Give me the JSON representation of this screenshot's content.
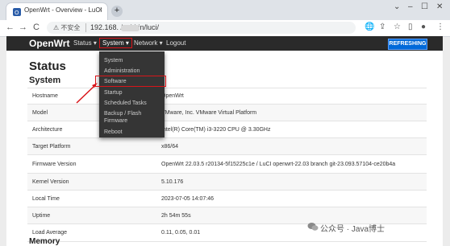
{
  "browser": {
    "tab_title": "OpenWrt - Overview - LuCI",
    "tab_close": "×",
    "new_tab": "+",
    "window_controls": [
      "⌄",
      "–",
      "☐",
      "✕"
    ],
    "security_label": "⚠ 不安全",
    "url": "192.168.              /cgi-bin/luci/",
    "nav": {
      "back": "←",
      "forward": "→",
      "reload": "C"
    }
  },
  "header": {
    "brand": "OpenWrt",
    "menu": {
      "status": "Status ▾",
      "system": "System ▾",
      "network": "Network ▾",
      "logout": "Logout"
    },
    "refresh_label": "REFRESHING",
    "colors": {
      "bar": "#2a2a2a",
      "refresh": "#0069d9",
      "highlight": "#d9151a"
    }
  },
  "dropdown": {
    "items": [
      "System",
      "Administration",
      "Software",
      "Startup",
      "Scheduled Tasks",
      "Backup / Flash",
      "Firmware",
      "Reboot"
    ],
    "highlighted": "Software"
  },
  "page": {
    "title": "Status",
    "section": "System",
    "rows": [
      {
        "label": "Hostname",
        "value": "OpenWrt"
      },
      {
        "label": "Model",
        "value": "VMware, Inc. VMware Virtual Platform"
      },
      {
        "label": "Architecture",
        "value": "Intel(R) Core(TM) i3-3220 CPU @ 3.30GHz"
      },
      {
        "label": "Target Platform",
        "value": "x86/64"
      },
      {
        "label": "Firmware Version",
        "value": "OpenWrt 22.03.5 r20134-5f15225c1e / LuCI openwrt-22.03 branch git-23.093.57104-ce20b4a"
      },
      {
        "label": "Kernel Version",
        "value": "5.10.176"
      },
      {
        "label": "Local Time",
        "value": "2023-07-05 14:07:46"
      },
      {
        "label": "Uptime",
        "value": "2h 54m 55s"
      },
      {
        "label": "Load Average",
        "value": "0.11, 0.05, 0.01"
      }
    ],
    "next_section": "Memory"
  },
  "watermark": "公众号 · Java博士"
}
